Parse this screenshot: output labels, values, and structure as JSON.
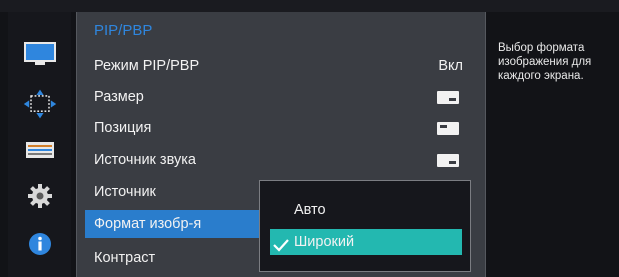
{
  "sidebar": {
    "icons": [
      "monitor-icon",
      "pip-move-icon",
      "settings-sliders-icon",
      "gear-icon",
      "info-icon"
    ]
  },
  "menu": {
    "title": "PIP/PBP",
    "rows": [
      {
        "label": "Режим PIP/PBP",
        "value": "Вкл"
      },
      {
        "label": "Размер",
        "icon": "size-large-icon"
      },
      {
        "label": "Позиция",
        "icon": "position-topleft-icon"
      },
      {
        "label": "Источник звука",
        "icon": "sound-source-icon"
      },
      {
        "label": "Источник"
      },
      {
        "label": "Формат изобр-я"
      },
      {
        "label": "Контраст"
      }
    ]
  },
  "popup": {
    "options": [
      {
        "label": "Авто"
      },
      {
        "label": "Широкий"
      }
    ]
  },
  "help": {
    "text": "Выбор формата изображения для каждого экрана."
  },
  "colors": {
    "accent_blue": "#2a7dcc",
    "title_blue": "#2f86de",
    "selected_teal": "#23b8b0",
    "panel_bg": "#3a3d43"
  }
}
